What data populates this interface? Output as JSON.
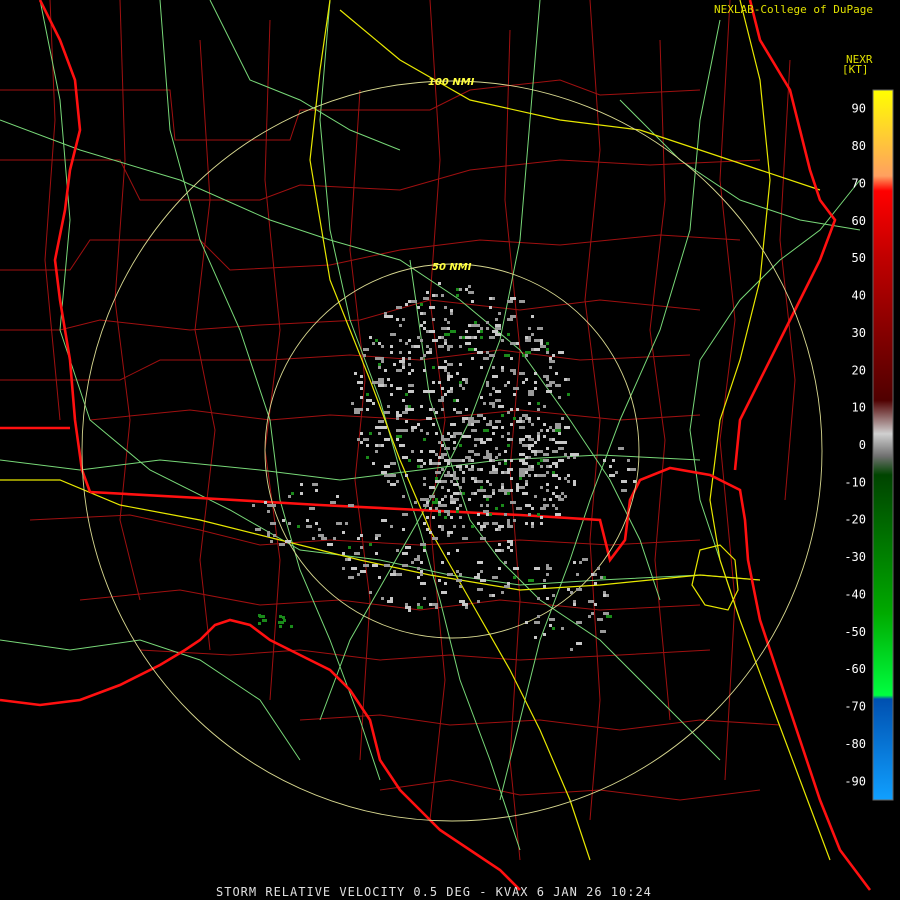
{
  "header": {
    "credit": "NEXLAB-College of DuPage",
    "product_code": "NEXR",
    "unit": "[KT]"
  },
  "footer": {
    "caption": "STORM RELATIVE VELOCITY 0.5 DEG - KVAX 6 JAN 26 10:24"
  },
  "map": {
    "rings": [
      {
        "label": "50 NMI"
      },
      {
        "label": "100 NMI"
      }
    ],
    "colors": {
      "background": "#000000",
      "county_lines": "#a01010",
      "state_lines": "#ff1010",
      "rivers_roads": "#78d878",
      "interstates": "#e8e800",
      "rings": "#d8d890",
      "echo_light": "#c8c8c8",
      "echo_green": "#1a8a1a"
    }
  },
  "legend": {
    "ticks": [
      "90",
      "80",
      "70",
      "60",
      "50",
      "40",
      "30",
      "20",
      "10",
      "0",
      "-10",
      "-20",
      "-30",
      "-40",
      "-50",
      "-60",
      "-70",
      "-80",
      "-90"
    ],
    "stops": [
      {
        "value": 95,
        "color": "#ffff00"
      },
      {
        "value": 72,
        "color": "#ffa060"
      },
      {
        "value": 68,
        "color": "#ff0000"
      },
      {
        "value": 50,
        "color": "#c00000"
      },
      {
        "value": 12,
        "color": "#500000"
      },
      {
        "value": 3,
        "color": "#d0d0d0"
      },
      {
        "value": -3,
        "color": "#707070"
      },
      {
        "value": -8,
        "color": "#004400"
      },
      {
        "value": -45,
        "color": "#00aa00"
      },
      {
        "value": -67,
        "color": "#00ff40"
      },
      {
        "value": -68,
        "color": "#0050b0"
      },
      {
        "value": -95,
        "color": "#10a0ff"
      }
    ]
  }
}
